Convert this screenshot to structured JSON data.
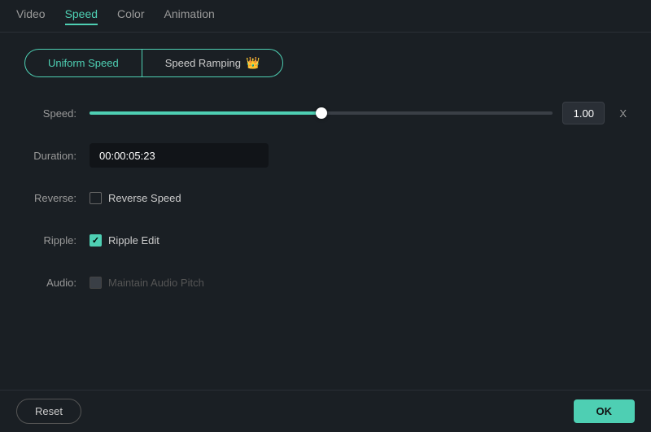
{
  "nav": {
    "tabs": [
      {
        "id": "video",
        "label": "Video",
        "active": false
      },
      {
        "id": "speed",
        "label": "Speed",
        "active": true
      },
      {
        "id": "color",
        "label": "Color",
        "active": false
      },
      {
        "id": "animation",
        "label": "Animation",
        "active": false
      }
    ]
  },
  "speed_section": {
    "uniform_speed_label": "Uniform Speed",
    "speed_ramping_label": "Speed Ramping",
    "crown_icon": "👑",
    "speed_row": {
      "label": "Speed:",
      "value": "1.00",
      "unit": "X",
      "slider_percent": 50
    },
    "duration_row": {
      "label": "Duration:",
      "value": "00:00:05:23"
    },
    "reverse_row": {
      "label": "Reverse:",
      "checkbox_checked": false,
      "checkbox_label": "Reverse Speed"
    },
    "ripple_row": {
      "label": "Ripple:",
      "checkbox_checked": true,
      "checkbox_label": "Ripple Edit"
    },
    "audio_row": {
      "label": "Audio:",
      "checkbox_checked": false,
      "checkbox_label": "Maintain Audio Pitch",
      "disabled": true
    }
  },
  "bottom_bar": {
    "reset_label": "Reset",
    "ok_label": "OK"
  }
}
